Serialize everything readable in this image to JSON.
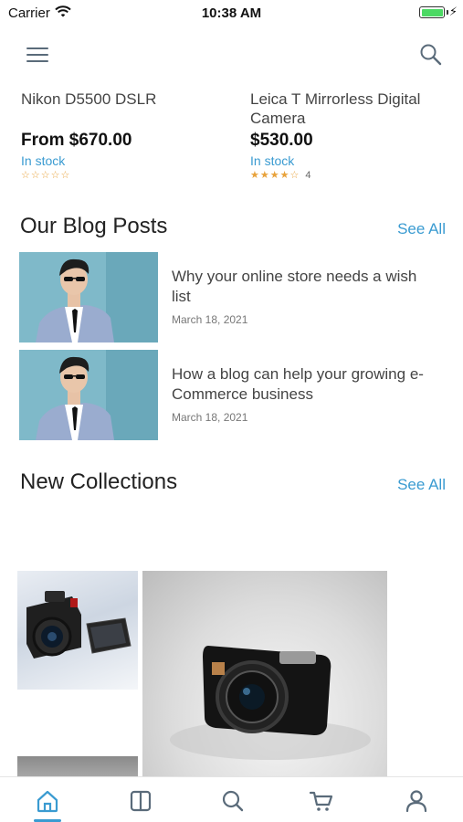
{
  "status_bar": {
    "carrier": "Carrier",
    "time": "10:38 AM",
    "battery_level": 1.0
  },
  "products": [
    {
      "name": "Nikon D5500 DSLR",
      "price": "From $670.00",
      "stock": "In stock",
      "rating": 0,
      "stars": "☆☆☆☆☆",
      "rating_count": ""
    },
    {
      "name": "Leica T Mirrorless Digital Camera",
      "price": "$530.00",
      "stock": "In stock",
      "rating": 4,
      "stars": "★★★★☆",
      "rating_count": "4"
    }
  ],
  "blog": {
    "title": "Our Blog Posts",
    "see_all": "See All",
    "posts": [
      {
        "title": "Why your online store needs a wish list",
        "date": "March 18, 2021"
      },
      {
        "title": "How a blog can help your growing e-Commerce business",
        "date": "March 18, 2021"
      }
    ]
  },
  "collections": {
    "title": "New Collections",
    "see_all": "See All"
  },
  "tab_bar": {
    "items": [
      "home-icon",
      "catalog-icon",
      "search-icon",
      "cart-icon",
      "account-icon"
    ],
    "active": "home-icon"
  },
  "colors": {
    "accent": "#3a9bd1",
    "star": "#e8a23b",
    "icon": "#5a6b7a"
  }
}
